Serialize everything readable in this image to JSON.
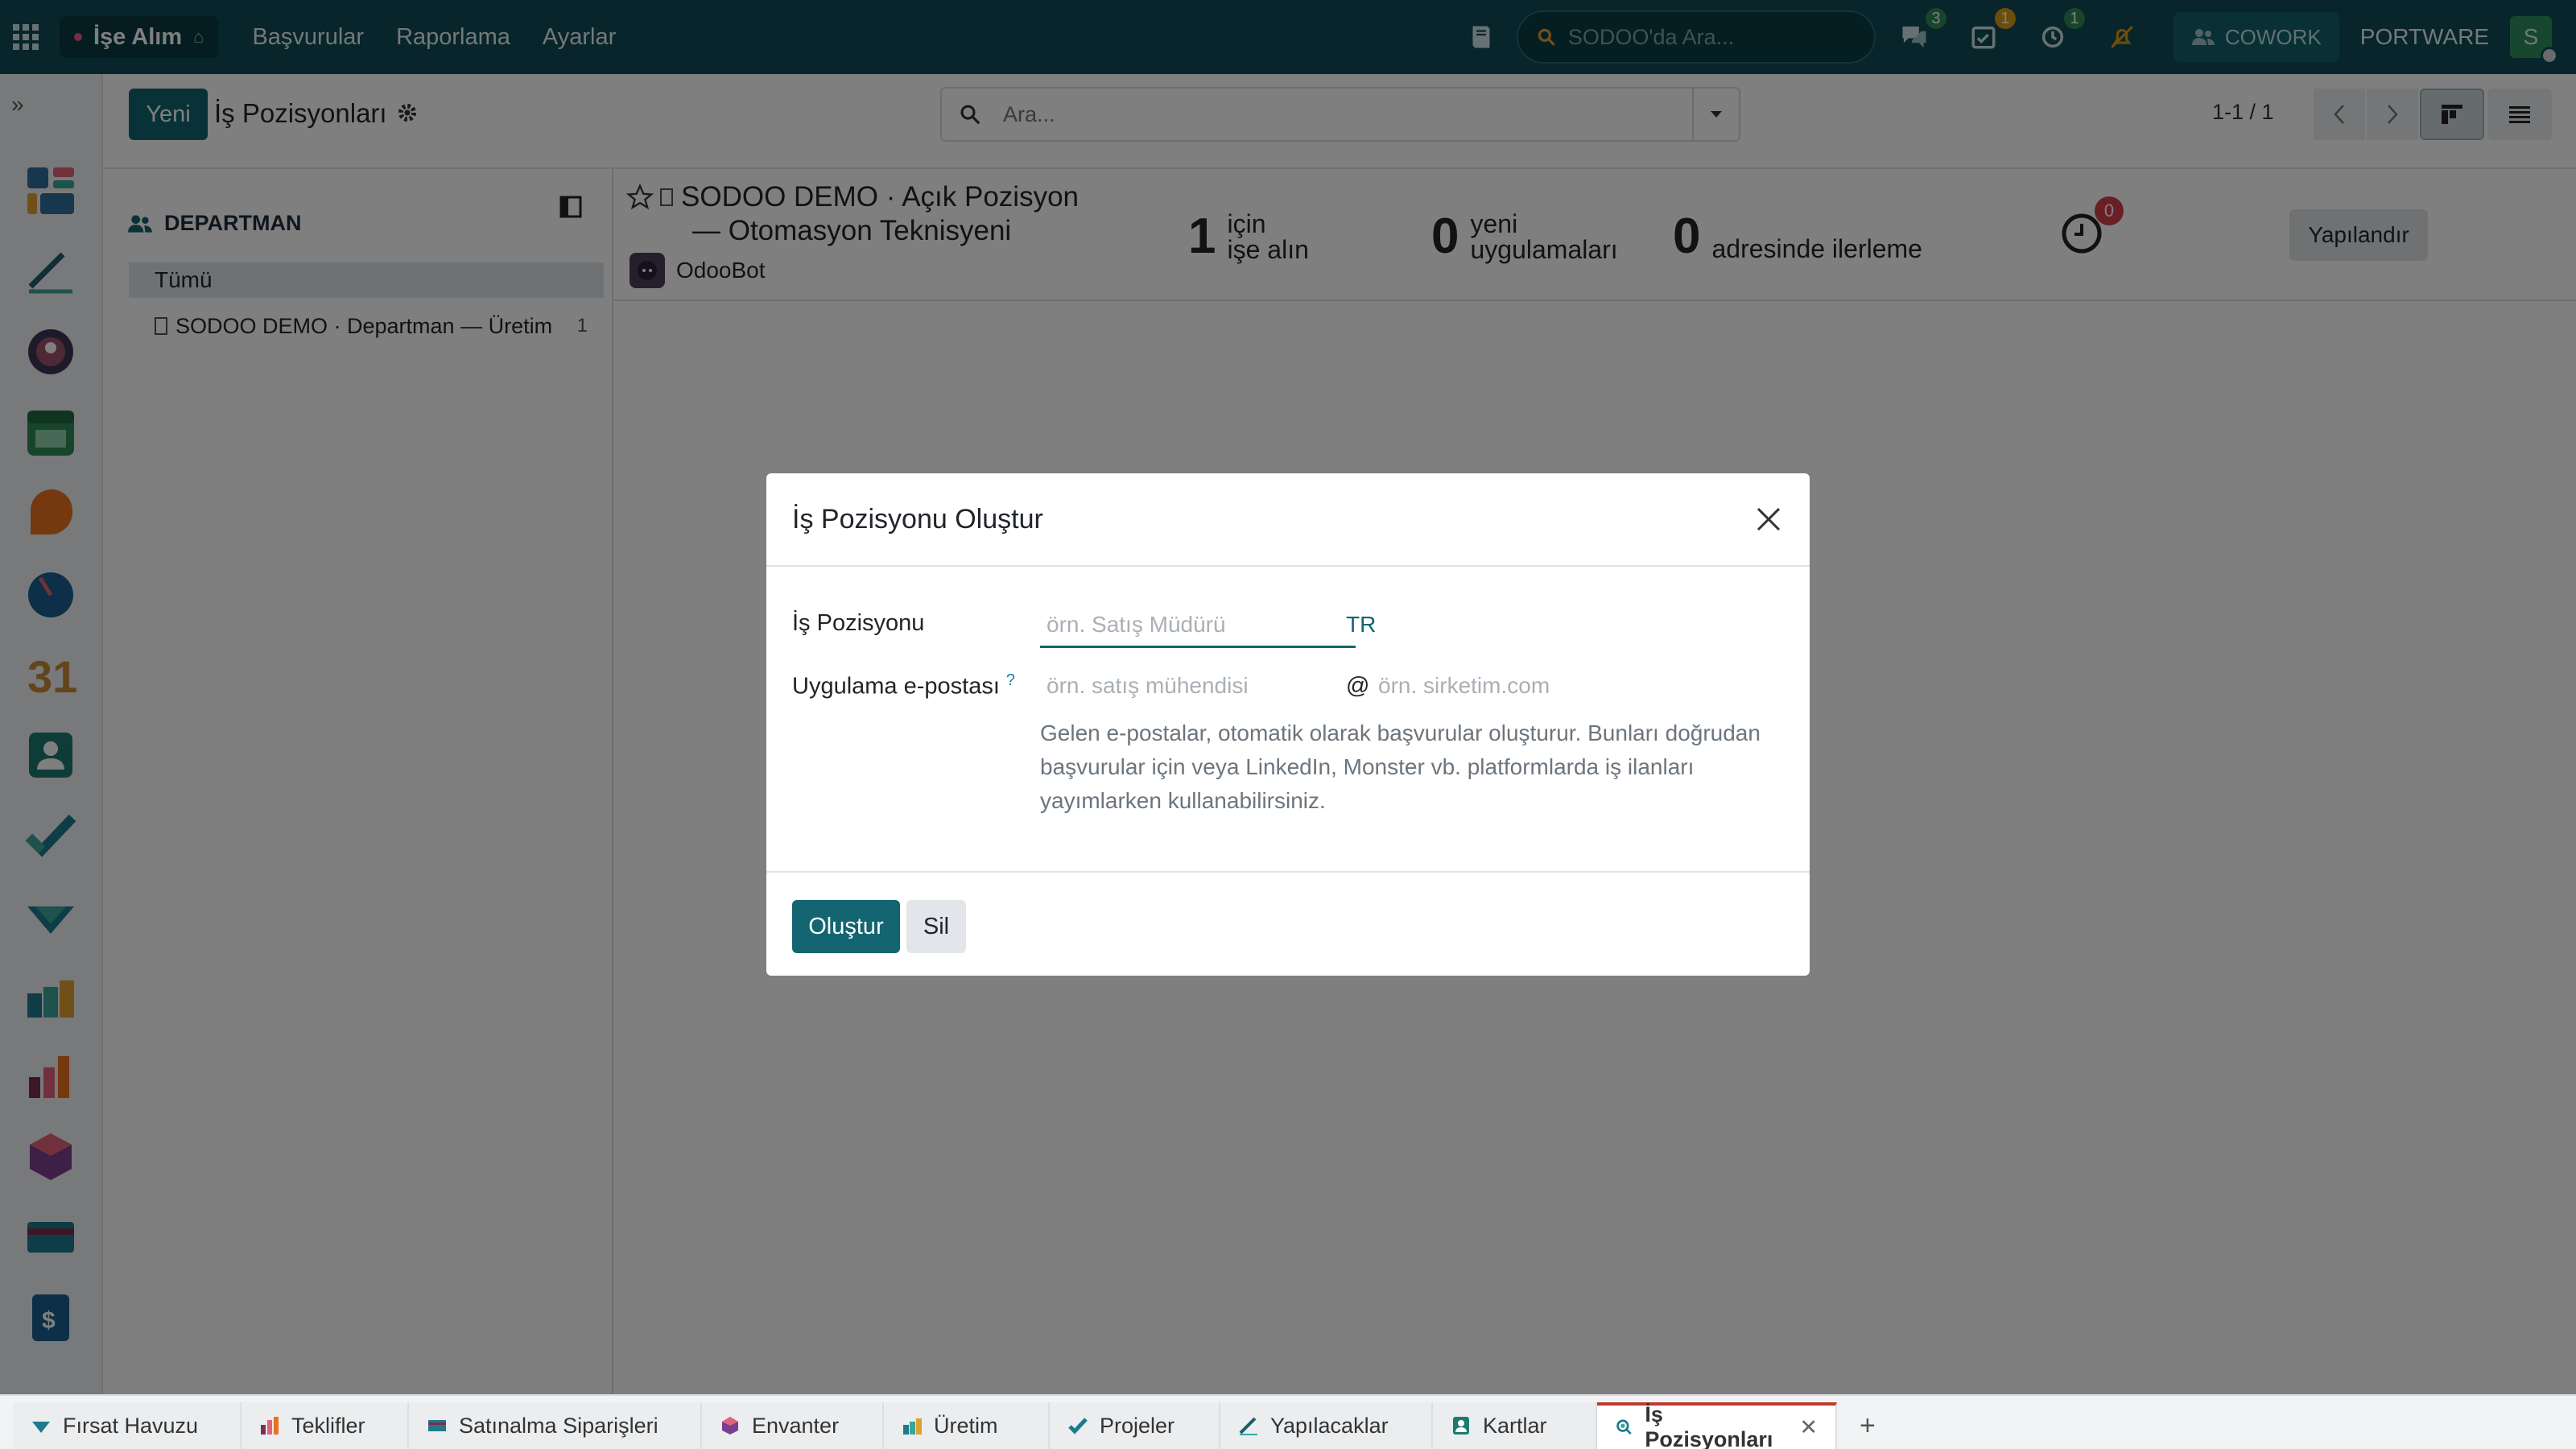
{
  "topbar": {
    "app_name": "İşe Alım",
    "menu": [
      "Başvurular",
      "Raporlama",
      "Ayarlar"
    ],
    "search_placeholder": "SODOO'da Ara...",
    "messages_count": "3",
    "activities_count": "1",
    "timer_count": "1",
    "cowork_label": "COWORK",
    "company": "PORTWARE",
    "avatar_initial": "S"
  },
  "control_panel": {
    "new_button": "Yeni",
    "breadcrumb_title": "İş Pozisyonları",
    "search_placeholder": "Ara...",
    "pager": "1-1 / 1"
  },
  "side_panel": {
    "header": "DEPARTMAN",
    "all_label": "Tümü",
    "items": [
      {
        "label": "SODOO DEMO · Departman — Üretim",
        "count": "1"
      }
    ]
  },
  "job_card": {
    "title_line1": "SODOO DEMO · Açık Pozisyon",
    "title_line2": "— Otomasyon Teknisyeni",
    "owner": "OdooBot",
    "stat_hire": {
      "num": "1",
      "line1": "için",
      "line2": "işe alın"
    },
    "stat_new": {
      "num": "0",
      "line1": "yeni",
      "line2": "uygulamaları"
    },
    "stat_progress": {
      "num": "0",
      "line1": "adresinde ilerleme"
    },
    "activity_badge": "0",
    "configure_button": "Yapılandır"
  },
  "modal": {
    "title": "İş Pozisyonu Oluştur",
    "job_position_label": "İş Pozisyonu",
    "job_position_placeholder": "örn. Satış Müdürü",
    "lang_badge": "TR",
    "email_label": "Uygulama e-postası",
    "email_help_mark": "?",
    "email_local_placeholder": "örn. satış mühendisi",
    "email_at": "@",
    "email_domain_placeholder": "örn. sirketim.com",
    "help_text": "Gelen e-postalar, otomatik olarak başvurular oluşturur. Bunları doğrudan başvurular için veya LinkedIn, Monster vb. platformlarda iş ilanları yayımlarken kullanabilirsiniz.",
    "create_button": "Oluştur",
    "discard_button": "Sil"
  },
  "tabs": [
    {
      "label": "Fırsat Havuzu",
      "icon": "crm-icon"
    },
    {
      "label": "Teklifler",
      "icon": "sales-icon"
    },
    {
      "label": "Satınalma Siparişleri",
      "icon": "purchase-icon"
    },
    {
      "label": "Envanter",
      "icon": "inventory-icon"
    },
    {
      "label": "Üretim",
      "icon": "manufacturing-icon"
    },
    {
      "label": "Projeler",
      "icon": "project-icon"
    },
    {
      "label": "Yapılacaklar",
      "icon": "todo-icon"
    },
    {
      "label": "Kartlar",
      "icon": "contacts-icon"
    },
    {
      "label": "İş Pozisyonları",
      "icon": "recruitment-icon",
      "active": true
    }
  ],
  "colors": {
    "brand": "#0e4b55",
    "primary": "#126571",
    "danger_badge": "#d23f4a"
  }
}
